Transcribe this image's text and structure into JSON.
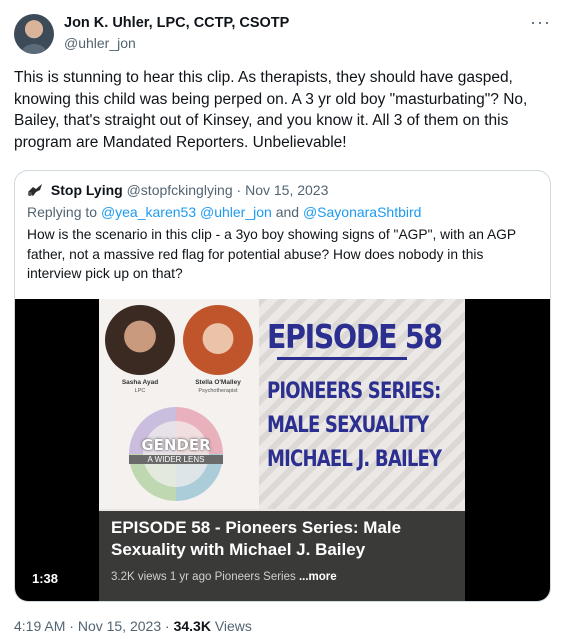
{
  "tweet": {
    "author_name": "Jon K. Uhler, LPC, CCTP, CSOTP",
    "author_handle": "@uhler_jon",
    "more_glyph": "···",
    "text": "This is stunning to hear this clip. As therapists, they should have gasped, knowing this child was being perped on. A 3 yr old boy \"masturbating\"? No, Bailey, that's straight out of Kinsey, and you know it. All 3 of them on this program are Mandated Reporters. Unbelievable!",
    "time": "4:19 AM",
    "date": "Nov 15, 2023",
    "views_count": "34.3K",
    "views_label": "Views"
  },
  "quote": {
    "author_name": "Stop Lying",
    "author_handle": "@stopfckinglying",
    "date": "Nov 15, 2023",
    "replying_to_label": "Replying to",
    "replying_to_1": "@yea_karen53",
    "replying_to_2": "@uhler_jon",
    "replying_and": "and",
    "replying_to_3": "@SayonaraShtbird",
    "text": "How is the scenario in this clip - a 3yo boy showing signs of \"AGP\", with an AGP father, not a massive red flag for potential abuse? How does nobody in this interview pick up on that?"
  },
  "video": {
    "duration": "1:38",
    "guest1_name": "Sasha Ayad",
    "guest1_role": "LPC",
    "guest2_name": "Stella O'Malley",
    "guest2_role": "Psychotherapist",
    "logo_line1": "GENDER",
    "logo_line2": "A WIDER LENS",
    "episode_big": "EPISODE 58",
    "series_line1": "PIONEERS SERIES:",
    "series_line2": "MALE SEXUALITY",
    "series_line3": "MICHAEL J. BAILEY",
    "overlay_title": "EPISODE 58 - Pioneers Series: Male Sexuality with Michael J. Bailey",
    "overlay_views": "3.2K views",
    "overlay_age": "1 yr ago",
    "overlay_channel": "Pioneers Series",
    "overlay_more": "...more"
  }
}
